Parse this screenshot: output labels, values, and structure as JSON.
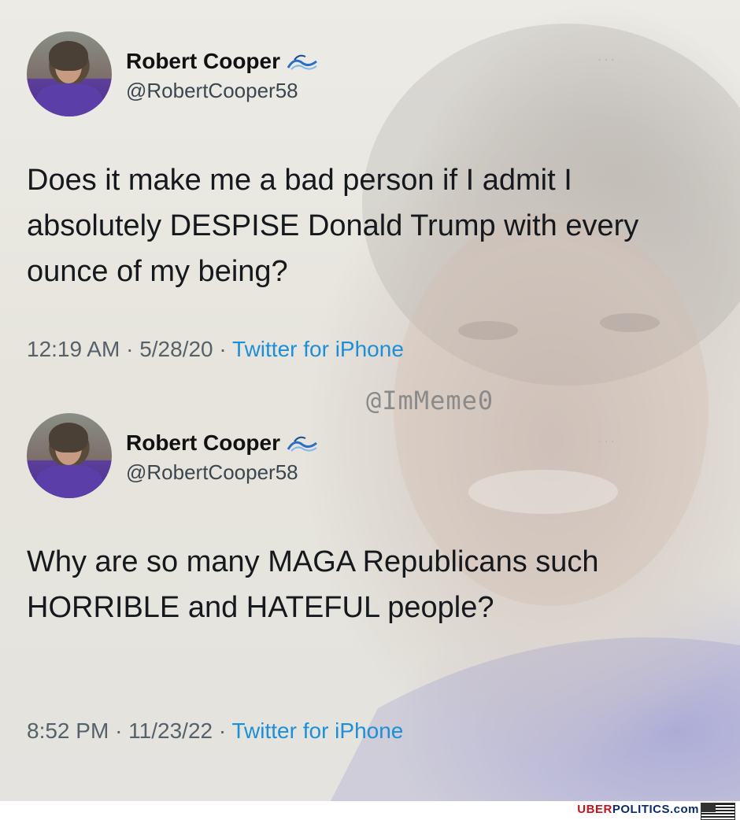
{
  "tweets": [
    {
      "display_name": "Robert Cooper",
      "handle": "@RobertCooper58",
      "text": "Does it make me a bad person if I admit I absolutely DESPISE Donald Trump with every ounce of my being?",
      "time": "12:19 AM",
      "date": "5/28/20",
      "source": "Twitter for iPhone",
      "separator": "·"
    },
    {
      "display_name": "Robert Cooper",
      "handle": "@RobertCooper58",
      "text": "Why are so many MAGA Republicans such HORRIBLE and HATEFUL people?",
      "time": "8:52 PM",
      "date": "11/23/22",
      "source": "Twitter for iPhone",
      "separator": "·"
    }
  ],
  "watermark": "@ImMeme0",
  "footer": {
    "brand_red": "UBER",
    "brand_blue": "POLITICS.com"
  },
  "icons": {
    "name_badge": "wave-icon",
    "more": "more-icon",
    "flag": "us-flag-icon"
  },
  "colors": {
    "link": "#1d8fd8",
    "brand_red": "#c1121f",
    "brand_blue": "#0b2a6e"
  }
}
